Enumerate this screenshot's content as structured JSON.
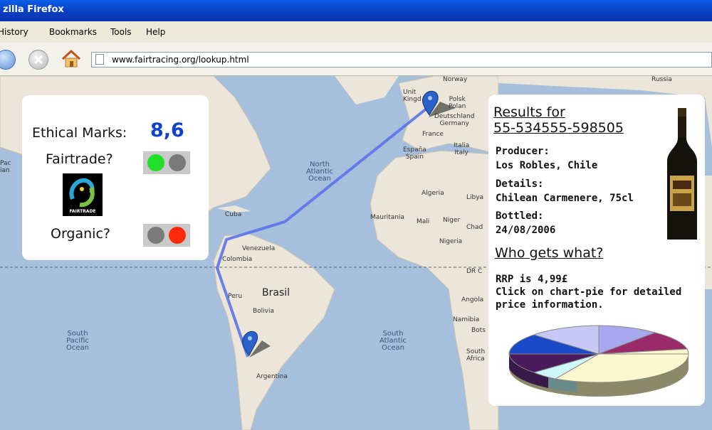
{
  "window": {
    "title": "zilla Firefox"
  },
  "menu": {
    "history": "History",
    "bookmarks": "Bookmarks",
    "tools": "Tools",
    "help": "Help"
  },
  "address_bar": {
    "url": "www.fairtracing.org/lookup.html"
  },
  "map_labels": {
    "norway": "Norway",
    "russia": "Russia",
    "uk": "Unit\nKingd",
    "polska": "Polsk\nPolan",
    "deutschland": "Deutschland\nGermany",
    "france": "France",
    "espana": "España\nSpain",
    "italia": "Italia\nItaly",
    "north_atlantic": "North\nAtlantic\nOcean",
    "algeria": "Algeria",
    "libya": "Libya",
    "mauritania": "Mauritania",
    "mali": "Mali",
    "niger": "Niger",
    "chad": "Chad",
    "nigeria": "Nigeria",
    "dr_congo": "DR C",
    "angola": "Angola",
    "namibia": "Namibia",
    "botswana": "Bots",
    "south_africa": "South\nAfrica",
    "cuba": "Cuba",
    "venezuela": "Venezuela",
    "colombia": "Colombia",
    "peru": "Peru",
    "brasil": "Brasil",
    "bolivia": "Bolivia",
    "argentina": "Argentina",
    "south_pacific": "South\nPacific\nOcean",
    "south_atlantic": "South\nAtlantic\nOcean",
    "pacific_edge": "Pac\nian"
  },
  "left_panel": {
    "ethical_label": "Ethical Marks:",
    "ethical_value": "8,6",
    "fairtrade_label": "Fairtrade?",
    "fairtrade_logo_text": "FAIRTRADE",
    "organic_label": "Organic?"
  },
  "indicators": {
    "on_green": "#22e02a",
    "on_red": "#ff2a0a",
    "off": "#7a7a7a"
  },
  "right_panel": {
    "results_title_line1": "Results for",
    "results_title_line2": "55-534555-598505",
    "producer_label": "Producer:",
    "producer_value": "Los Robles, Chile",
    "details_label": "Details:",
    "details_value": "Chilean Carmenere, 75cl",
    "bottled_label": "Bottled:",
    "bottled_value": "24/08/2006",
    "who_gets_what": "Who gets what?",
    "rrp": "RRP is 4,99£",
    "click_line1": "Click on chart-pie for detailed",
    "click_line2": "price information."
  },
  "colors": {
    "route": "#5b73e8",
    "ocean": "#a5bfdd",
    "land": "#ebe6d9",
    "ethical_value": "#1140cc"
  }
}
